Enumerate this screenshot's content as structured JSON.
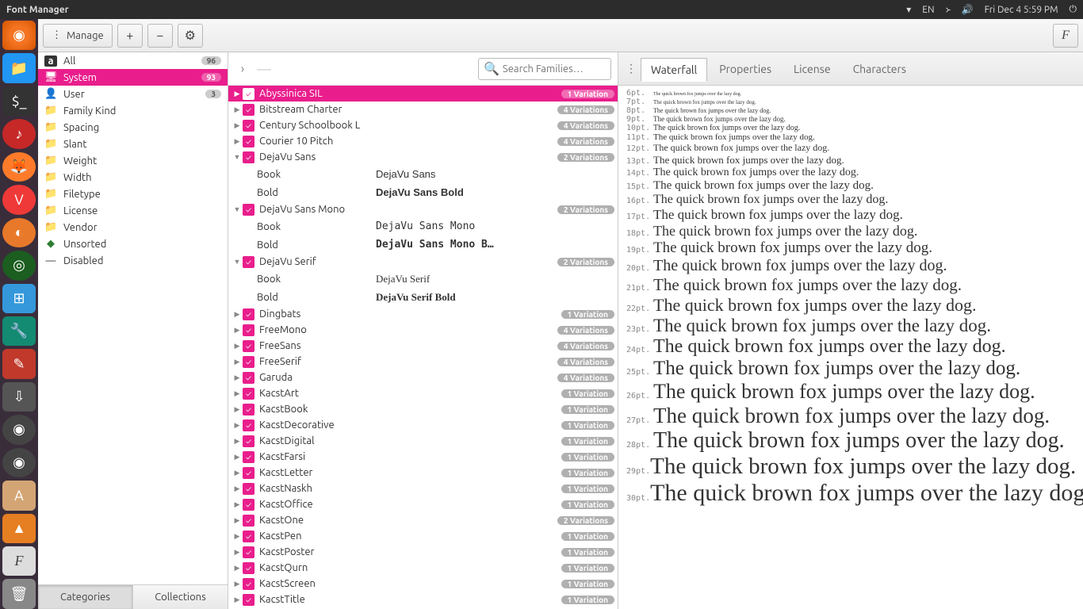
{
  "topbar": {
    "title": "Font Manager",
    "lang": "EN",
    "clock": "Fri Dec 4  5:59 PM"
  },
  "toolbar": {
    "manage": "Manage"
  },
  "sidebar": {
    "categories_btn": "Categories",
    "collections_btn": "Collections",
    "items": [
      {
        "icon": "a",
        "label": "All",
        "badge": "96"
      },
      {
        "icon": "🖥",
        "label": "System",
        "badge": "93",
        "sel": true
      },
      {
        "icon": "👤",
        "label": "User",
        "badge": "3"
      },
      {
        "icon": "📁",
        "label": "Family Kind"
      },
      {
        "icon": "📁",
        "label": "Spacing"
      },
      {
        "icon": "📁",
        "label": "Slant"
      },
      {
        "icon": "📁",
        "label": "Weight"
      },
      {
        "icon": "📁",
        "label": "Width"
      },
      {
        "icon": "📁",
        "label": "Filetype"
      },
      {
        "icon": "📁",
        "label": "License"
      },
      {
        "icon": "📁",
        "label": "Vendor"
      },
      {
        "icon": "◆",
        "label": "Unsorted",
        "green": true
      },
      {
        "icon": "—",
        "label": "Disabled"
      }
    ]
  },
  "search": {
    "placeholder": "Search Families…"
  },
  "fonts": [
    {
      "name": "Abyssinica SIL",
      "v": "1 Variation",
      "sel": true
    },
    {
      "name": "Bitstream Charter",
      "v": "4 Variations"
    },
    {
      "name": "Century Schoolbook L",
      "v": "4 Variations"
    },
    {
      "name": "Courier 10 Pitch",
      "v": "4 Variations"
    },
    {
      "name": "DejaVu Sans",
      "v": "2 Variations",
      "exp": true,
      "styles": [
        {
          "style": "Book",
          "sample": "DejaVu Sans",
          "bold": false,
          "ff": "sans-serif"
        },
        {
          "style": "Bold",
          "sample": "DejaVu Sans Bold",
          "bold": true,
          "ff": "sans-serif"
        }
      ]
    },
    {
      "name": "DejaVu Sans Mono",
      "v": "2 Variations",
      "exp": true,
      "styles": [
        {
          "style": "Book",
          "sample": "DejaVu Sans Mono",
          "bold": false,
          "ff": "monospace"
        },
        {
          "style": "Bold",
          "sample": "DejaVu Sans Mono B…",
          "bold": true,
          "ff": "monospace"
        }
      ]
    },
    {
      "name": "DejaVu Serif",
      "v": "2 Variations",
      "exp": true,
      "styles": [
        {
          "style": "Book",
          "sample": "DejaVu Serif",
          "bold": false,
          "ff": "serif"
        },
        {
          "style": "Bold",
          "sample": "DejaVu Serif Bold",
          "bold": true,
          "ff": "serif"
        }
      ]
    },
    {
      "name": "Dingbats",
      "v": "1 Variation"
    },
    {
      "name": "FreeMono",
      "v": "4 Variations"
    },
    {
      "name": "FreeSans",
      "v": "4 Variations"
    },
    {
      "name": "FreeSerif",
      "v": "4 Variations"
    },
    {
      "name": "Garuda",
      "v": "4 Variations"
    },
    {
      "name": "KacstArt",
      "v": "1 Variation"
    },
    {
      "name": "KacstBook",
      "v": "1 Variation"
    },
    {
      "name": "KacstDecorative",
      "v": "1 Variation"
    },
    {
      "name": "KacstDigital",
      "v": "1 Variation"
    },
    {
      "name": "KacstFarsi",
      "v": "1 Variation"
    },
    {
      "name": "KacstLetter",
      "v": "1 Variation"
    },
    {
      "name": "KacstNaskh",
      "v": "1 Variation"
    },
    {
      "name": "KacstOffice",
      "v": "1 Variation"
    },
    {
      "name": "KacstOne",
      "v": "2 Variations"
    },
    {
      "name": "KacstPen",
      "v": "1 Variation"
    },
    {
      "name": "KacstPoster",
      "v": "1 Variation"
    },
    {
      "name": "KacstQurn",
      "v": "1 Variation"
    },
    {
      "name": "KacstScreen",
      "v": "1 Variation"
    },
    {
      "name": "KacstTitle",
      "v": "1 Variation"
    }
  ],
  "preview": {
    "tabs": [
      "Waterfall",
      "Properties",
      "License",
      "Characters"
    ],
    "active_tab": 0,
    "sample_text": "The quick brown fox jumps over the lazy dog.",
    "sizes": [
      6,
      7,
      8,
      9,
      10,
      11,
      12,
      13,
      14,
      15,
      16,
      17,
      18,
      19,
      20,
      21,
      22,
      23,
      24,
      25,
      26,
      27,
      28,
      29,
      30
    ]
  }
}
